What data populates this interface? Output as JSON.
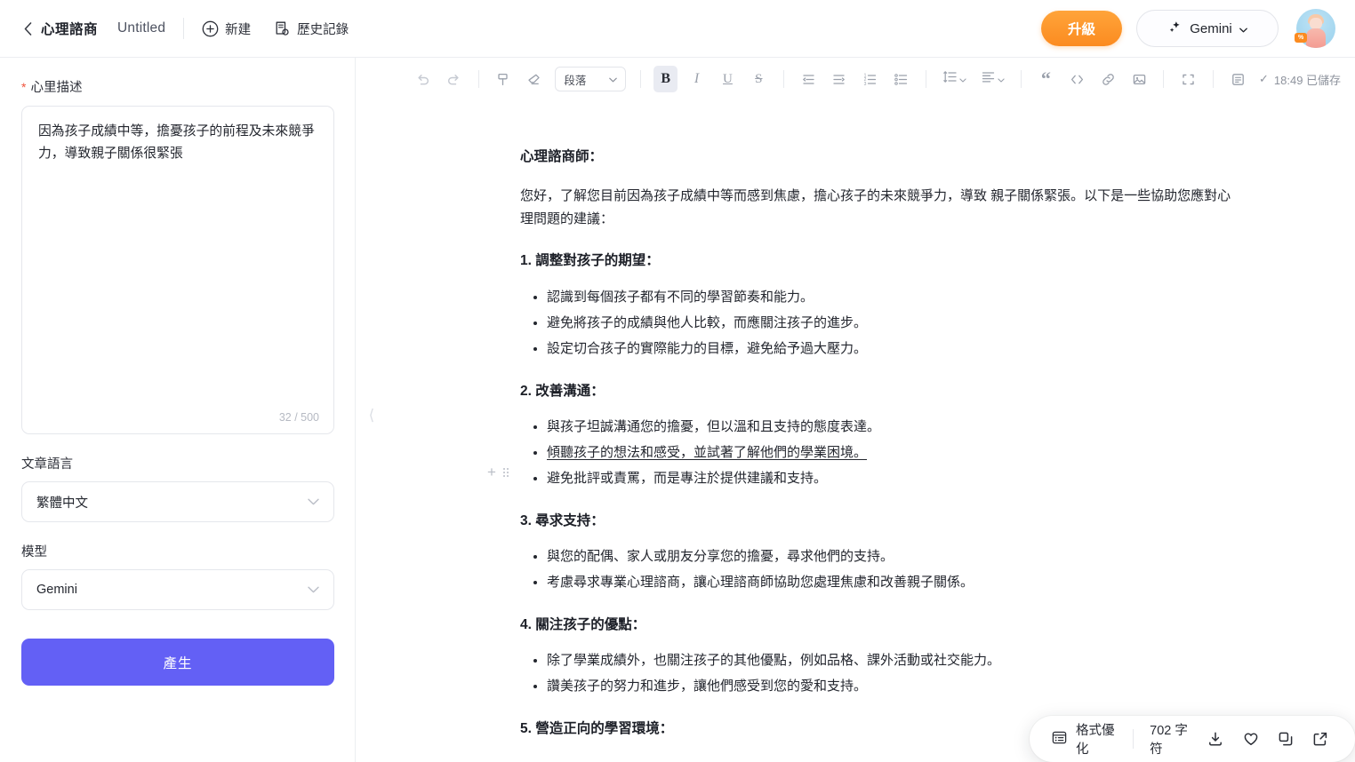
{
  "topbar": {
    "back_icon": "chevron-left-icon",
    "app_title": "心理諮商",
    "doc_title": "Untitled",
    "new_label": "新建",
    "new_icon": "plus-circle-icon",
    "history_label": "歷史記錄",
    "history_icon": "history-document-icon",
    "upgrade_label": "升級",
    "model_label": "Gemini",
    "model_icon": "sparkle-icon",
    "model_caret": "caret-down-icon",
    "avatar_badge": "%"
  },
  "sidebar": {
    "description_label": "心里描述",
    "required_mark": "*",
    "description_value": "因為孩子成績中等，擔憂孩子的前程及未來競爭力，導致親子關係很緊張",
    "char_count": "32 / 500",
    "language_label": "文章語言",
    "language_value": "繁體中文",
    "model_label": "模型",
    "model_value": "Gemini",
    "generate_label": "產生"
  },
  "editor_toolbar": {
    "undo": "undo-icon",
    "redo": "redo-icon",
    "format_paint": "format-paint-icon",
    "clear_format": "clear-format-icon",
    "style_value": "段落",
    "bold": "B",
    "italic": "I",
    "underline": "U",
    "strike": "S",
    "outdent": "outdent-icon",
    "indent": "indent-icon",
    "ordered_list": "ordered-list-icon",
    "bullet_list": "bullet-list-icon",
    "line_height": "line-height-icon",
    "align": "align-icon",
    "quote": "quote-icon",
    "code": "code-icon",
    "link": "link-icon",
    "image": "image-icon",
    "fullscreen": "fullscreen-icon",
    "save": "save-icon",
    "saved_check": "✓",
    "saved_status": "18:49 已儲存"
  },
  "collapse_handle": "⟨",
  "document": {
    "heading": "心理諮商師：",
    "intro": "您好，了解您目前因為孩子成績中等而感到焦慮，擔心孩子的未來競爭力，導致 親子關係緊張。以下是一些協助您應對心理問題的建議：",
    "sections": [
      {
        "title": "1. 調整對孩子的期望：",
        "items": [
          "認識到每個孩子都有不同的學習節奏和能力。",
          "避免將孩子的成績與他人比較，而應關注孩子的進步。",
          "設定切合孩子的實際能力的目標，避免給予過大壓力。"
        ]
      },
      {
        "title": "2. 改善溝通：",
        "items": [
          "與孩子坦誠溝通您的擔憂，但以溫和且支持的態度表達。",
          "傾聽孩子的想法和感受，並試著了解他們的學業困境。",
          "避免批評或責罵，而是專注於提供建議和支持。"
        ]
      },
      {
        "title": "3. 尋求支持：",
        "items": [
          "與您的配偶、家人或朋友分享您的擔憂，尋求他們的支持。",
          "考慮尋求專業心理諮商，讓心理諮商師協助您處理焦慮和改善親子關係。"
        ]
      },
      {
        "title": "4. 關注孩子的優點：",
        "items": [
          "除了學業成績外，也關注孩子的其他優點，例如品格、課外活動或社交能力。",
          "讚美孩子的努力和進步，讓他們感受到您的愛和支持。"
        ]
      },
      {
        "title": "5. 營造正向的學習環境：",
        "items": []
      }
    ]
  },
  "float_bar": {
    "optimize_label": "格式優化",
    "optimize_icon": "format-optimize-icon",
    "char_count": "702 字符",
    "download_icon": "download-icon",
    "favorite_icon": "heart-icon",
    "copy_icon": "copy-icon",
    "share_icon": "external-link-icon"
  },
  "colors": {
    "accent_purple": "#6360f5",
    "upgrade_orange": "#fb8b20",
    "required_red": "#f0533c"
  }
}
